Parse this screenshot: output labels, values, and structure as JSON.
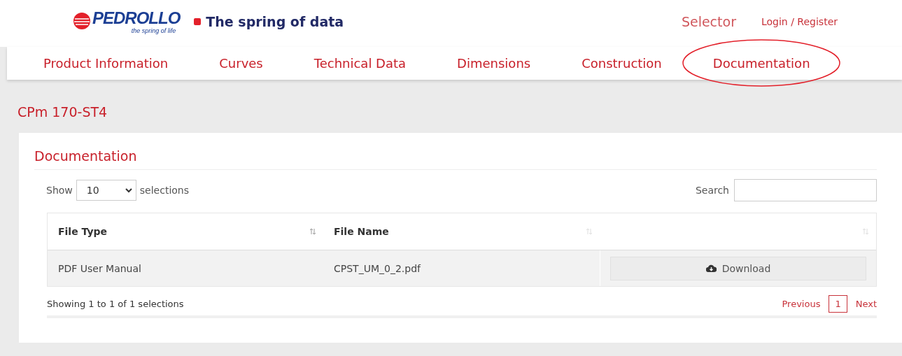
{
  "header": {
    "logo": {
      "brand": "PEDROLLO",
      "tagline": "the spring of life"
    },
    "slogan": "The spring of data",
    "links": [
      "Selector",
      "Login / Register"
    ]
  },
  "tabs": [
    {
      "label": "Product Information"
    },
    {
      "label": "Curves"
    },
    {
      "label": "Technical Data"
    },
    {
      "label": "Dimensions"
    },
    {
      "label": "Construction"
    },
    {
      "label": "Documentation"
    }
  ],
  "annotations": [
    {
      "kind": "ellipse"
    }
  ],
  "product_title": "CPm 170-ST4",
  "panel": {
    "title": "Documentation",
    "length": {
      "prefix": "Show",
      "value": "10",
      "suffix": "selections"
    },
    "search": {
      "label": "Search"
    },
    "table": {
      "columns": [
        "File Type",
        "File Name"
      ],
      "rows": [
        {
          "file_type": "PDF User Manual",
          "file_name": "CPST_UM_0_2.pdf",
          "action": "Download"
        }
      ]
    },
    "info": "Showing 1 to 1 of 1 selections",
    "pagination": {
      "previous": "Previous",
      "pages": [
        {
          "label": "1",
          "selected": true
        }
      ],
      "next": "Next"
    }
  }
}
